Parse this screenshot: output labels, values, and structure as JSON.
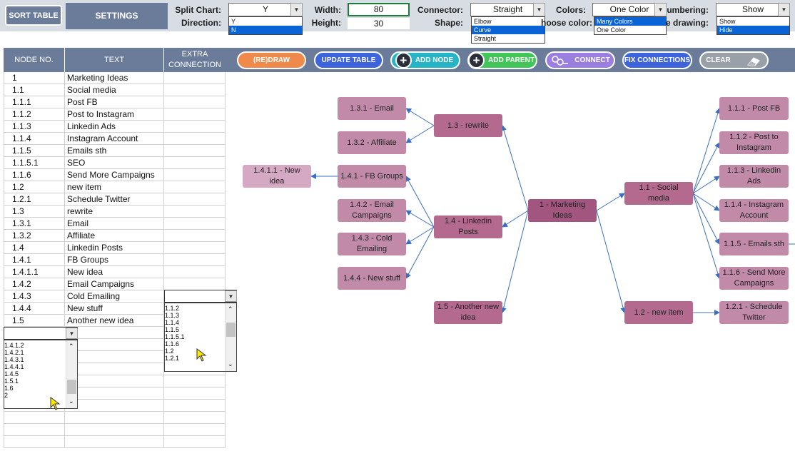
{
  "toolbar": {
    "sort_label": "SORT TABLE",
    "settings_label": "SETTINGS",
    "split_chart_label": "Split Chart:",
    "split_chart_value": "Y",
    "split_options": [
      "Y",
      "N"
    ],
    "split_selected_index": 1,
    "direction_label": "Direction:",
    "width_label": "Width:",
    "width_value": "80",
    "height_label": "Height:",
    "height_value": "30",
    "connector_label": "Connector:",
    "connector_value": "Straight",
    "connector_options": [
      "Elbow",
      "Curve",
      "Straight"
    ],
    "connector_selected_index": 1,
    "shape_label": "Shape:",
    "colors_label": "Colors:",
    "colors_value": "One Color",
    "colors_options": [
      "Many Colors",
      "One Color"
    ],
    "colors_selected_index": 0,
    "choose_color_label": "hoose color:",
    "numbering_label": "umbering:",
    "numbering_value": "Show",
    "numbering_options": [
      "Show",
      "Hide"
    ],
    "numbering_selected_index": 1,
    "drawing_label": "e drawing:"
  },
  "table": {
    "headers": [
      "NODE NO.",
      "TEXT",
      "EXTRA\nCONNECTION"
    ],
    "rows": [
      [
        "1",
        "Marketing Ideas"
      ],
      [
        "1.1",
        "Social media"
      ],
      [
        "1.1.1",
        "Post FB"
      ],
      [
        "1.1.2",
        "Post to Instagram"
      ],
      [
        "1.1.3",
        "Linkedin Ads"
      ],
      [
        "1.1.4",
        "Instagram Account"
      ],
      [
        "1.1.5",
        "Emails sth"
      ],
      [
        "1.1.5.1",
        "SEO"
      ],
      [
        "1.1.6",
        "Send More Campaigns"
      ],
      [
        "1.2",
        "new item"
      ],
      [
        "1.2.1",
        "Schedule Twitter"
      ],
      [
        "1.3",
        "rewrite"
      ],
      [
        "1.3.1",
        "Email"
      ],
      [
        "1.3.2",
        "Affiliate"
      ],
      [
        "1.4",
        "Linkedin Posts"
      ],
      [
        "1.4.1",
        "FB Groups"
      ],
      [
        "1.4.1.1",
        "New idea"
      ],
      [
        "1.4.2",
        "Email Campaigns"
      ],
      [
        "1.4.3",
        "Cold Emailing"
      ],
      [
        "1.4.4",
        "New stuff"
      ],
      [
        "1.5",
        "Another new idea"
      ]
    ],
    "node_dropdown_options": [
      "1.4.1.2",
      "1.4.2.1",
      "1.4.3.1",
      "1.4.4.1",
      "1.4.5",
      "1.5.1",
      "1.6",
      "2"
    ],
    "node_dropdown_selected_index": 6,
    "connection_dropdown_options": [
      "1.1.2",
      "1.1.3",
      "1.1.4",
      "1.1.5",
      "1.1.5.1",
      "1.1.6",
      "1.2",
      "1.2.1"
    ],
    "connection_dropdown_selected_index": 5
  },
  "actions": {
    "redraw": "(RE)DRAW",
    "update_table": "UPDATE TABLE",
    "add_node": "ADD NODE",
    "add_parent": "ADD PARENT",
    "connect": "CONNECT",
    "fix_connections": "FIX CONNECTIONS",
    "clear": "CLEAR"
  },
  "colors": {
    "header_bg": "#6b7c9a",
    "redraw_btn": "#f08a4b",
    "update_btn": "#3d63dd",
    "add_node_btn": "#26b5c6",
    "add_parent_btn": "#43c659",
    "connect_btn": "#9b7fe0",
    "fix_btn": "#3d63dd",
    "clear_btn": "#9aa0a8",
    "node_root": "#a2567f",
    "node_level1": "#b4698e",
    "node_default": "#c18aa9",
    "node_deep": "#d5a9c3",
    "connector_line": "#3a6fc4"
  },
  "mindmap": {
    "nodes": [
      {
        "label": "1 - Marketing Ideas",
        "level": "root"
      },
      {
        "label": "1.1 - Social media",
        "level": "level1"
      },
      {
        "label": "1.1.1 - Post FB",
        "level": "default"
      },
      {
        "label": "1.1.2 - Post to Instagram",
        "level": "default"
      },
      {
        "label": "1.1.3 - Linkedin Ads",
        "level": "default"
      },
      {
        "label": "1.1.4 - Instagram Account",
        "level": "default"
      },
      {
        "label": "1.1.5 - Emails sth",
        "level": "default"
      },
      {
        "label": "1.1.6 - Send More Campaigns",
        "level": "default"
      },
      {
        "label": "1.2 - new item",
        "level": "level1"
      },
      {
        "label": "1.2.1 - Schedule Twitter",
        "level": "default"
      },
      {
        "label": "1.3 - rewrite",
        "level": "level1"
      },
      {
        "label": "1.3.1 - Email",
        "level": "default"
      },
      {
        "label": "1.3.2 - Affiliate",
        "level": "default"
      },
      {
        "label": "1.4 - Linkedin Posts",
        "level": "level1"
      },
      {
        "label": "1.4.1 - FB Groups",
        "level": "default"
      },
      {
        "label": "1.4.1.1 - New idea",
        "level": "deep"
      },
      {
        "label": "1.4.2 - Email Campaigns",
        "level": "default"
      },
      {
        "label": "1.4.3 - Cold Emailing",
        "level": "default"
      },
      {
        "label": "1.4.4 - New stuff",
        "level": "default"
      },
      {
        "label": "1.5 - Another new idea",
        "level": "level1"
      }
    ]
  }
}
